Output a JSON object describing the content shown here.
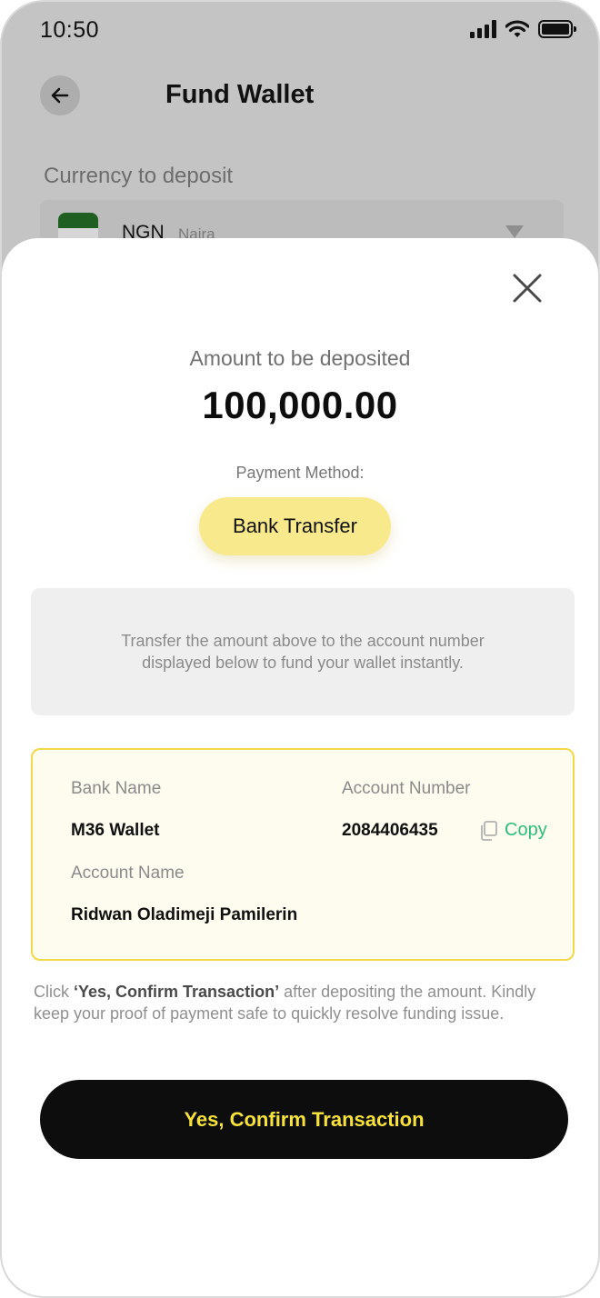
{
  "status_bar": {
    "time": "10:50"
  },
  "header": {
    "title": "Fund Wallet"
  },
  "currency": {
    "label": "Currency to deposit",
    "code": "NGN",
    "name": "Naira"
  },
  "sheet": {
    "amount_label": "Amount to be deposited",
    "amount_value": "100,000.00",
    "payment_method_label": "Payment Method:",
    "payment_method_value": "Bank Transfer",
    "info_text": "Transfer the amount above to the account number displayed below to fund your wallet instantly.",
    "account": {
      "bank_name_label": "Bank Name",
      "bank_name": "M36 Wallet",
      "account_number_label": "Account Number",
      "account_number": "2084406435",
      "copy_label": "Copy",
      "account_name_label": "Account Name",
      "account_name": "Ridwan Oladimeji Pamilerin"
    },
    "note_emphasis": "‘Yes, Confirm Transaction’",
    "note_prefix": "Click ",
    "note_suffix": " after depositing the amount. Kindly keep your proof of payment safe to quickly resolve funding issue.",
    "confirm_label": "Yes, Confirm Transaction"
  },
  "colors": {
    "accent_yellow": "#f8e98c",
    "button_text_yellow": "#f7e13a",
    "copy_green": "#2dbd7a",
    "card_border": "#f2d94a"
  },
  "icons": [
    "signal-icon",
    "wifi-icon",
    "battery-icon",
    "back-arrow-icon",
    "chevron-down-icon",
    "close-icon",
    "copy-icon"
  ]
}
